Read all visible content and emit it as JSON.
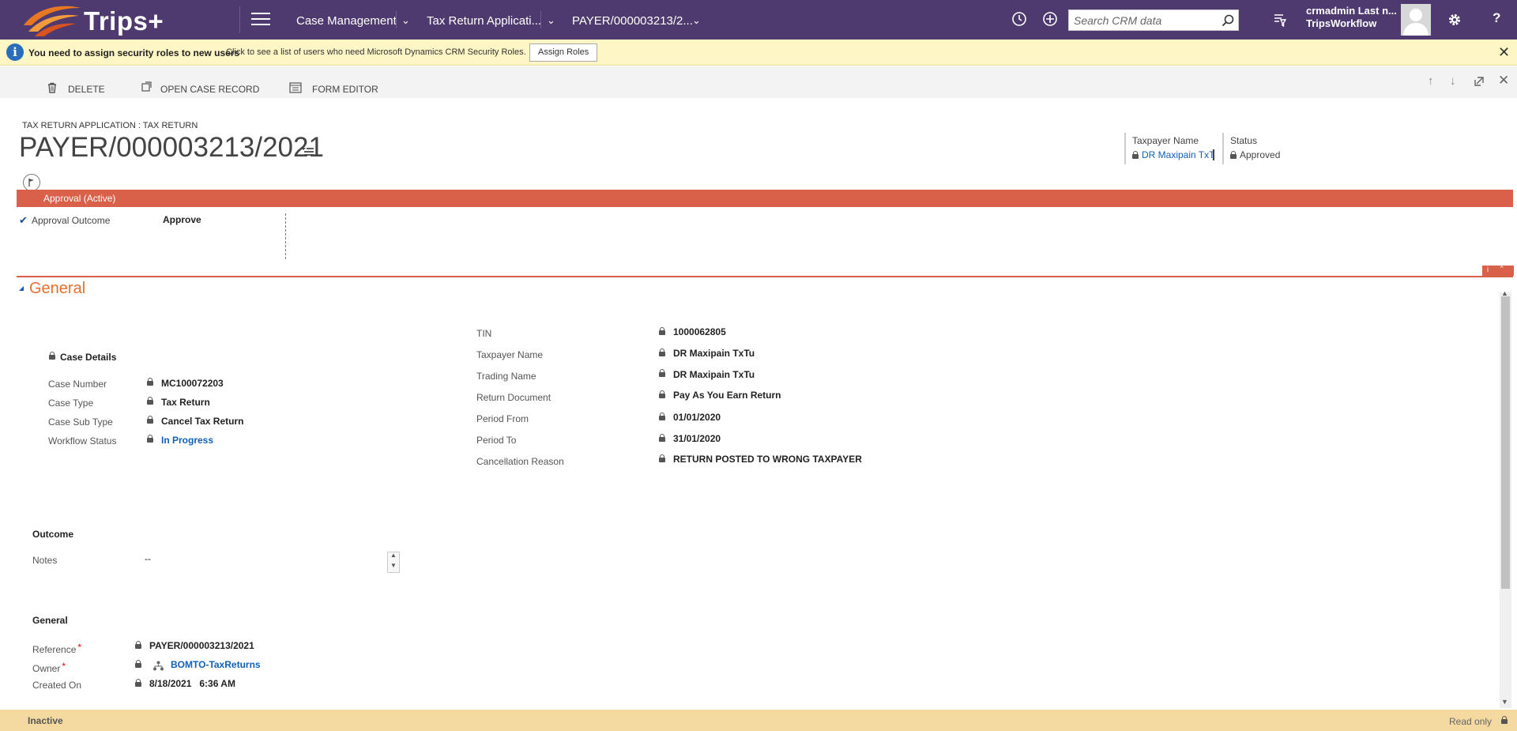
{
  "colors": {
    "nav_bg": "#4e3a6f",
    "notification_bg": "#fff6c5",
    "stage_bar": "#d9614a",
    "section_title": "#e5712d",
    "link": "#1160b7",
    "status_bar": "#f4d9a1"
  },
  "nav": {
    "logo": "Trips+",
    "breadcrumb_1": "Case Management",
    "breadcrumb_2": "Tax Return Applicati...",
    "breadcrumb_3": "PAYER/000003213/2...",
    "search_placeholder": "Search CRM data",
    "user_name": "crmadmin Last n...",
    "user_org": "TripsWorkflow",
    "icons": [
      "menu-icon",
      "recent-icon",
      "create-icon",
      "search-icon",
      "advanced-find-icon",
      "avatar",
      "settings-icon",
      "help-icon"
    ]
  },
  "notification": {
    "title": "You need to assign security roles to new users",
    "text": "Click to see a list of users who need Microsoft Dynamics CRM Security Roles.",
    "button": "Assign Roles"
  },
  "commands": {
    "delete": "DELETE",
    "open_case": "OPEN CASE RECORD",
    "form_editor": "FORM EDITOR"
  },
  "header": {
    "entity": "TAX RETURN APPLICATION : TAX RETURN",
    "title": "PAYER/000003213/2021",
    "fields": [
      {
        "label": "Taxpayer Name",
        "value": "DR Maxipain TxTu"
      },
      {
        "label": "Status",
        "value": "Approved"
      }
    ]
  },
  "process": {
    "stage": "Approval (Active)",
    "field_label": "Approval Outcome",
    "field_value": "Approve"
  },
  "section": {
    "title": "General"
  },
  "case_details": {
    "title": "Case Details",
    "fields": [
      {
        "label": "Case Number",
        "value": "MC100072203"
      },
      {
        "label": "Case Type",
        "value": "Tax Return"
      },
      {
        "label": "Case Sub Type",
        "value": "Cancel Tax Return"
      },
      {
        "label": "Workflow Status",
        "value": "In Progress"
      }
    ]
  },
  "return_details": {
    "fields": [
      {
        "label": "TIN",
        "value": "1000062805"
      },
      {
        "label": "Taxpayer Name",
        "value": "DR Maxipain TxTu"
      },
      {
        "label": "Trading Name",
        "value": "DR Maxipain TxTu"
      },
      {
        "label": "Return Document",
        "value": "Pay As You Earn Return"
      },
      {
        "label": "Period From",
        "value": "01/01/2020"
      },
      {
        "label": "Period To",
        "value": "31/01/2020"
      },
      {
        "label": "Cancellation Reason",
        "value": "RETURN POSTED TO WRONG TAXPAYER"
      }
    ]
  },
  "outcome": {
    "title": "Outcome",
    "notes_label": "Notes",
    "notes_value": "--"
  },
  "general": {
    "title": "General",
    "fields": [
      {
        "label": "Reference",
        "value": "PAYER/000003213/2021"
      },
      {
        "label": "Owner",
        "value": "BOMTO-TaxReturns"
      },
      {
        "label": "Created On",
        "value": "8/18/2021   6:36 AM"
      }
    ]
  },
  "status": {
    "state": "Inactive",
    "mode": "Read only"
  }
}
